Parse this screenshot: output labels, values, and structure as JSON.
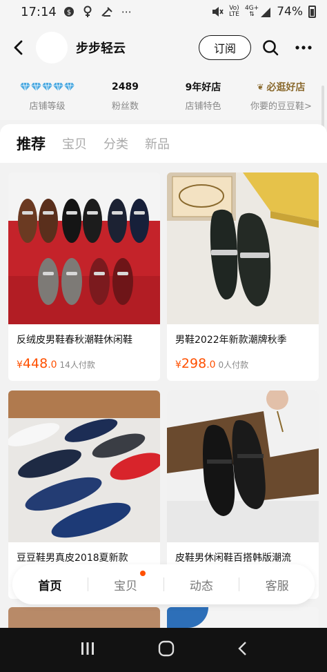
{
  "status_bar": {
    "time": "17:14",
    "network": "LTE",
    "network_top": "Vo)",
    "signal_label": "4G+",
    "battery": "74%"
  },
  "header": {
    "shop_name": "步步轻云",
    "subscribe_label": "订阅"
  },
  "stats": [
    {
      "value": "",
      "label": "店铺等级",
      "diamonds": 5
    },
    {
      "value": "2489",
      "label": "粉丝数"
    },
    {
      "value": "9年好店",
      "label": "店铺特色"
    },
    {
      "value": "必逛好店",
      "label": "你要的豆豆鞋>"
    }
  ],
  "tabs": [
    "推荐",
    "宝贝",
    "分类",
    "新品"
  ],
  "products": [
    {
      "title": "反绒皮男鞋春秋潮鞋休闲鞋",
      "currency": "¥",
      "price": "448",
      "price_decimal": ".0",
      "sold": "14人付款"
    },
    {
      "title": "男鞋2022年新款潮牌秋季",
      "currency": "¥",
      "price": "298",
      "price_decimal": ".0",
      "sold": "0人付款"
    },
    {
      "title": "豆豆鞋男真皮2018夏新款",
      "currency": "¥",
      "price": "",
      "price_decimal": "",
      "sold": ""
    },
    {
      "title": "皮鞋男休闲鞋百搭韩版潮流",
      "currency": "¥",
      "price": "",
      "price_decimal": "",
      "sold": ""
    }
  ],
  "bottom_nav": [
    "首页",
    "宝贝",
    "动态",
    "客服"
  ],
  "colors": {
    "accent": "#ff5000",
    "gold": "#8a6a2e",
    "diamond": "#4aa8e0"
  }
}
